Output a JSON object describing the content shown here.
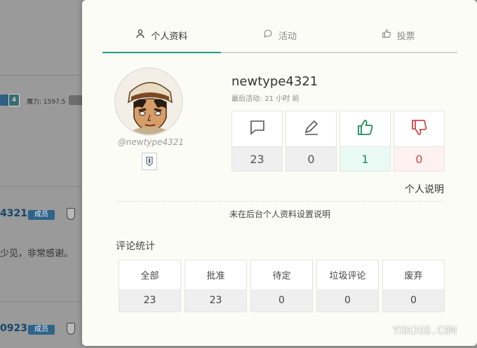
{
  "background": {
    "level_badge": "4",
    "mana_text": "魔力: 1597.5",
    "posts": [
      {
        "name": "4321",
        "role": "成员",
        "text": "少见，非常感谢。"
      },
      {
        "name": "0923",
        "role": "成员"
      }
    ]
  },
  "tabs": [
    {
      "label": "个人资料",
      "icon": "user-icon",
      "active": true
    },
    {
      "label": "活动",
      "icon": "chat-bubble-icon",
      "active": false
    },
    {
      "label": "投票",
      "icon": "thumbs-up-icon",
      "active": false
    }
  ],
  "profile": {
    "handle": "@newtype4321",
    "username": "newtype4321",
    "last_active_label": "最后活动:",
    "last_active_value": "21 小时 前"
  },
  "stats": [
    {
      "icon": "comment-icon",
      "value": "23",
      "variant": "plain"
    },
    {
      "icon": "edit-icon",
      "value": "0",
      "variant": "plain"
    },
    {
      "icon": "thumbs-up-icon",
      "value": "1",
      "variant": "up"
    },
    {
      "icon": "thumbs-down-icon",
      "value": "0",
      "variant": "down"
    }
  ],
  "bio": {
    "title": "个人说明",
    "text": "未在后台个人资料设置说明"
  },
  "comments": {
    "title": "评论统计",
    "cells": [
      {
        "label": "全部",
        "value": "23"
      },
      {
        "label": "批准",
        "value": "23"
      },
      {
        "label": "待定",
        "value": "0"
      },
      {
        "label": "垃圾评论",
        "value": "0"
      },
      {
        "label": "废弃",
        "value": "0"
      }
    ]
  },
  "watermark": "YXHJGS.COM",
  "colors": {
    "accent": "#1ba189",
    "up": "#1c8c55",
    "down": "#d04848"
  }
}
